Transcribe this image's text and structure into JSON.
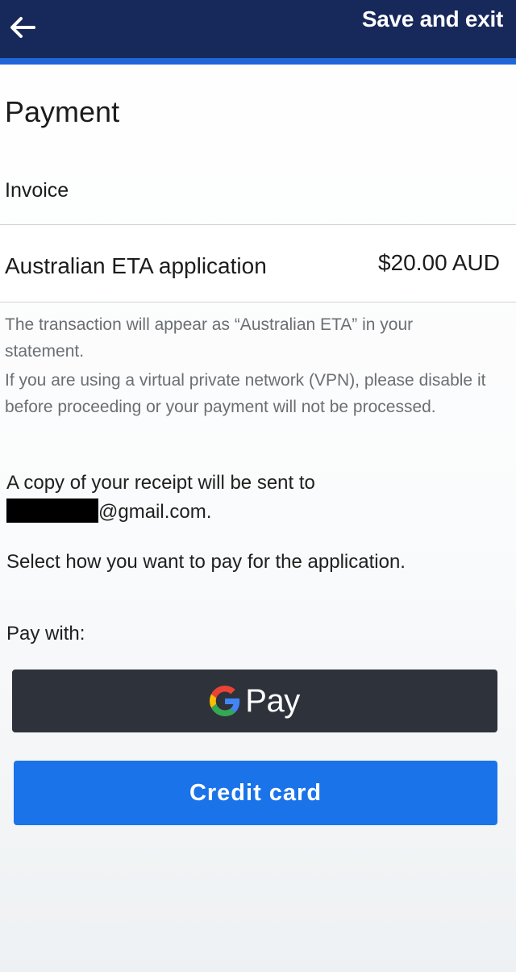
{
  "header": {
    "back_icon": "arrow-left-icon",
    "save_exit_label": "Save and exit",
    "colors": {
      "bar": "#17285a",
      "accent": "#1f66d8"
    }
  },
  "page": {
    "title": "Payment",
    "invoice_label": "Invoice"
  },
  "invoice": {
    "item": "Australian ETA application",
    "amount": "$20.00 AUD"
  },
  "notes": {
    "transaction": "The transaction will appear as “Australian ETA” in your statement.",
    "vpn": "If you are using a virtual private network (VPN), please disable it before proceeding or your payment will not be processed."
  },
  "receipt": {
    "intro": "A copy of your receipt will be sent to",
    "email_domain": "@gmail.com."
  },
  "instructions": "Select how you want to pay for the application.",
  "payment": {
    "pay_with_label": "Pay with:",
    "gpay_logo_icon": "google-g-icon",
    "gpay_label": "Pay",
    "credit_card_label": "Credit card",
    "colors": {
      "gpay": "#2e323b",
      "credit_card": "#1b73ea"
    }
  }
}
